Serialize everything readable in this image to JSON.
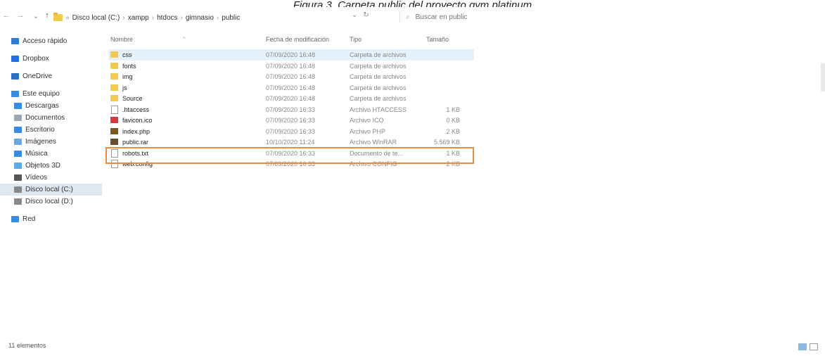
{
  "caption": "Figura 3. Carpeta public del proyecto gym platinum",
  "nav": {
    "back": "←",
    "forward": "→",
    "dropdown": "⌄",
    "up": "↑"
  },
  "breadcrumb": [
    "Disco local (C:)",
    "xampp",
    "htdocs",
    "gimnasio",
    "public"
  ],
  "address_controls": {
    "dropdown": "⌄",
    "refresh": "↻"
  },
  "search": {
    "placeholder": "Buscar en public"
  },
  "sidebar": {
    "items": [
      {
        "label": "Acceso rápido",
        "icon": "star-icon",
        "color": "#2f7dd1"
      },
      {
        "label": "Dropbox",
        "icon": "dropbox-icon",
        "color": "#1f6fe0"
      },
      {
        "label": "OneDrive",
        "icon": "cloud-icon",
        "color": "#2a6fbf"
      },
      {
        "label": "Este equipo",
        "icon": "computer-icon",
        "color": "#3a8be0"
      },
      {
        "label": "Descargas",
        "icon": "download-icon",
        "color": "#3a8be0"
      },
      {
        "label": "Documentos",
        "icon": "document-icon",
        "color": "#9aa7b5"
      },
      {
        "label": "Escritorio",
        "icon": "desktop-icon",
        "color": "#3a8be0"
      },
      {
        "label": "Imágenes",
        "icon": "image-icon",
        "color": "#6aa6e0"
      },
      {
        "label": "Música",
        "icon": "music-icon",
        "color": "#3a8be0"
      },
      {
        "label": "Objetos 3D",
        "icon": "cube-icon",
        "color": "#5fa8e6"
      },
      {
        "label": "Vídeos",
        "icon": "video-icon",
        "color": "#555555"
      },
      {
        "label": "Disco local (C:)",
        "icon": "drive-icon",
        "color": "#888888"
      },
      {
        "label": "Disco local (D:)",
        "icon": "drive-icon",
        "color": "#888888"
      },
      {
        "label": "Red",
        "icon": "network-icon",
        "color": "#3a8be0"
      }
    ]
  },
  "columns": {
    "name": "Nombre",
    "date": "Fecha de modificación",
    "type": "Tipo",
    "size": "Tamaño"
  },
  "files": [
    {
      "name": "css",
      "date": "07/09/2020 16:48",
      "type": "Carpeta de archivos",
      "size": "",
      "kind": "folder"
    },
    {
      "name": "fonts",
      "date": "07/09/2020 16:48",
      "type": "Carpeta de archivos",
      "size": "",
      "kind": "folder"
    },
    {
      "name": "img",
      "date": "07/09/2020 16:48",
      "type": "Carpeta de archivos",
      "size": "",
      "kind": "folder"
    },
    {
      "name": "js",
      "date": "07/09/2020 16:48",
      "type": "Carpeta de archivos",
      "size": "",
      "kind": "folder"
    },
    {
      "name": "Source",
      "date": "07/09/2020 16:48",
      "type": "Carpeta de archivos",
      "size": "",
      "kind": "folder"
    },
    {
      "name": ".htaccess",
      "date": "07/09/2020 16:33",
      "type": "Archivo HTACCESS",
      "size": "1 KB",
      "kind": "file"
    },
    {
      "name": "favicon.ico",
      "date": "07/09/2020 16:33",
      "type": "Archivo ICO",
      "size": "0 KB",
      "kind": "ico"
    },
    {
      "name": "index.php",
      "date": "07/09/2020 16:33",
      "type": "Archivo PHP",
      "size": "2 KB",
      "kind": "php"
    },
    {
      "name": "public.rar",
      "date": "10/10/2020 11:24",
      "type": "Archivo WinRAR",
      "size": "5.569 KB",
      "kind": "rar"
    },
    {
      "name": "robots.txt",
      "date": "07/09/2020 16:33",
      "type": "Documento de te...",
      "size": "1 KB",
      "kind": "file"
    },
    {
      "name": "web.config",
      "date": "07/09/2020 16:33",
      "type": "Archivo CONFIG",
      "size": "2 KB",
      "kind": "file"
    }
  ],
  "status": {
    "count": "11 elementos"
  },
  "colors": {
    "highlight_box": "#f08a3e",
    "selected_row": "#e5f1fb",
    "folder": "#f2c94c"
  }
}
